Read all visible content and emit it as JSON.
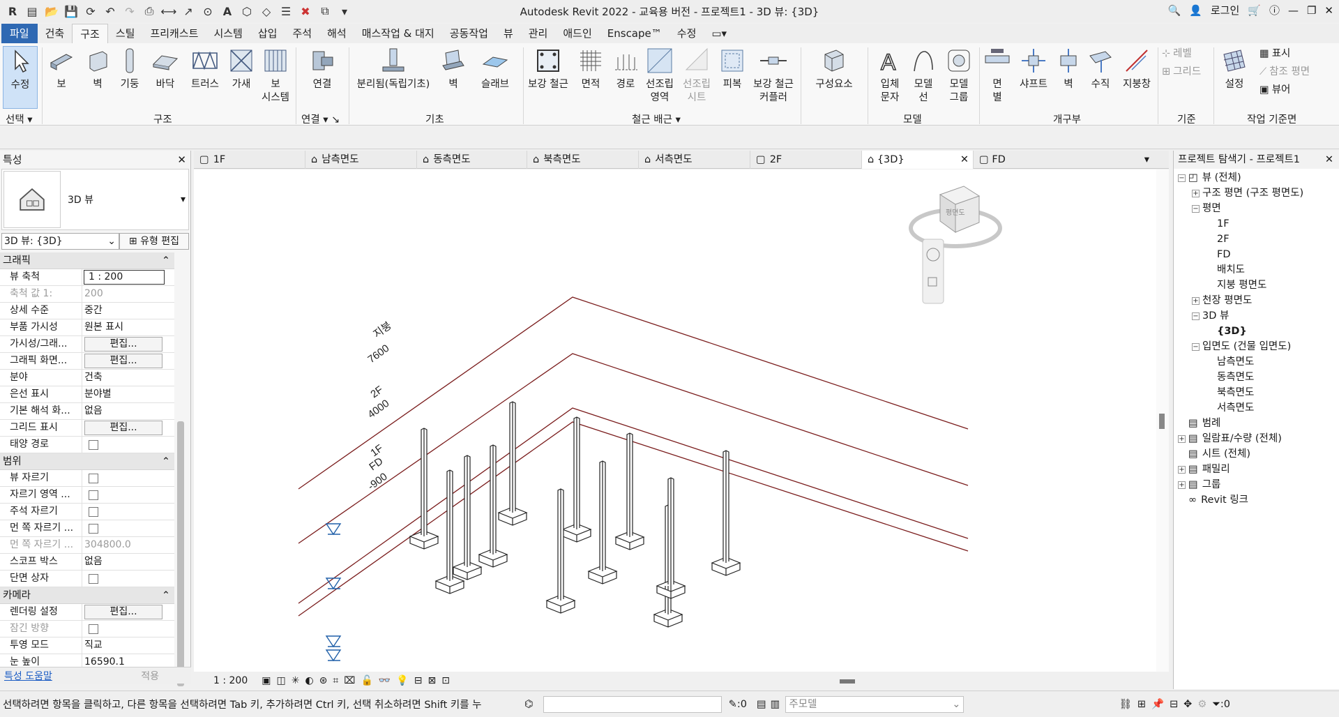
{
  "window": {
    "title": "Autodesk Revit 2022 - 교육용 버전 - 프로젝트1 - 3D 뷰: {3D}",
    "login": "로그인"
  },
  "ribbon_tabs": [
    "파일",
    "건축",
    "구조",
    "스틸",
    "프리캐스트",
    "시스템",
    "삽입",
    "주석",
    "해석",
    "매스작업 & 대지",
    "공동작업",
    "뷰",
    "관리",
    "애드인",
    "Enscape™",
    "수정"
  ],
  "ribbon": {
    "modify": "수정",
    "select": "선택",
    "structure_btns": [
      "보",
      "벽",
      "기둥",
      "바닥",
      "트러스",
      "가새",
      "보\n시스템"
    ],
    "connection_btn": "연결",
    "foundation_btns": [
      "분리됨(독립기초)",
      "벽",
      "슬래브"
    ],
    "rebar_btns": [
      "보강 철근",
      "면적",
      "경로",
      "선조립\n영역",
      "선조립\n시트",
      "피복",
      "보강 철근\n커플러"
    ],
    "component_btn": "구성요소",
    "model_btns": [
      "입체\n문자",
      "모델\n선",
      "모델\n그룹"
    ],
    "opening_btns": [
      "면\n별",
      "샤프트",
      "벽",
      "수직",
      "지붕창"
    ],
    "datum_btns": [
      "레벨",
      "그리드"
    ],
    "workplane_btns": [
      "설정",
      "표시",
      "참조 평면",
      "뷰어"
    ],
    "panels": [
      "구조",
      "연결",
      "기초",
      "철근 배근",
      "모델",
      "개구부",
      "기준",
      "작업 기준면"
    ]
  },
  "properties": {
    "header": "특성",
    "type_name": "3D 뷰",
    "selector": "3D 뷰: {3D}",
    "edit_type": "유형 편집",
    "groups": {
      "graphics": "그래픽",
      "extents": "범위",
      "camera": "카메라"
    },
    "graphics_rows": [
      {
        "k": "뷰 축척",
        "v": "1 : 200"
      },
      {
        "k": "축척 값    1:",
        "v": "200"
      },
      {
        "k": "상세 수준",
        "v": "중간"
      },
      {
        "k": "부품 가시성",
        "v": "원본 표시"
      },
      {
        "k": "가시성/그래...",
        "v": "편집..."
      },
      {
        "k": "그래픽 화면...",
        "v": "편집..."
      },
      {
        "k": "분야",
        "v": "건축"
      },
      {
        "k": "은선 표시",
        "v": "분야별"
      },
      {
        "k": "기본 해석 화...",
        "v": "없음"
      },
      {
        "k": "그리드 표시",
        "v": "편집..."
      },
      {
        "k": "태양 경로",
        "v": ""
      }
    ],
    "extents_rows": [
      {
        "k": "뷰 자르기",
        "v": ""
      },
      {
        "k": "자르기 영역 ...",
        "v": ""
      },
      {
        "k": "주석 자르기",
        "v": ""
      },
      {
        "k": "먼 쪽 자르기 ...",
        "v": ""
      },
      {
        "k": "먼 쪽 자르기 ...",
        "v": "304800.0"
      },
      {
        "k": "스코프 박스",
        "v": "없음"
      },
      {
        "k": "단면 상자",
        "v": ""
      }
    ],
    "camera_rows": [
      {
        "k": "렌더링 설정",
        "v": "편집..."
      },
      {
        "k": "잠긴 방향",
        "v": ""
      },
      {
        "k": "투영 모드",
        "v": "직교"
      },
      {
        "k": "눈 높이",
        "v": "16590.1"
      }
    ],
    "help": "특성 도움말",
    "apply": "적용"
  },
  "view_tabs": [
    "1F",
    "남측면도",
    "동측면도",
    "북측면도",
    "서측면도",
    "2F",
    "{3D}",
    "FD"
  ],
  "view": {
    "scale": "1 : 200",
    "levels": [
      {
        "name": "지붕",
        "elev": "7600"
      },
      {
        "name": "2F",
        "elev": "4000"
      },
      {
        "name": "1F",
        "elev": ""
      },
      {
        "name": "FD",
        "elev": "-900"
      }
    ],
    "viewcube_label": "평면도"
  },
  "browser": {
    "header": "프로젝트 탐색기 - 프로젝트1",
    "nodes": [
      {
        "label": "뷰 (전체)",
        "level": 0,
        "exp": "−"
      },
      {
        "label": "구조 평면 (구조 평면도)",
        "level": 1,
        "exp": "+"
      },
      {
        "label": "평면",
        "level": 1,
        "exp": "−"
      },
      {
        "label": "1F",
        "level": 2,
        "exp": ""
      },
      {
        "label": "2F",
        "level": 2,
        "exp": ""
      },
      {
        "label": "FD",
        "level": 2,
        "exp": ""
      },
      {
        "label": "배치도",
        "level": 2,
        "exp": ""
      },
      {
        "label": "지붕 평면도",
        "level": 2,
        "exp": ""
      },
      {
        "label": "천장 평면도",
        "level": 1,
        "exp": "+"
      },
      {
        "label": "3D 뷰",
        "level": 1,
        "exp": "−"
      },
      {
        "label": "{3D}",
        "level": 2,
        "exp": ""
      },
      {
        "label": "입면도 (건물 입면도)",
        "level": 1,
        "exp": "−"
      },
      {
        "label": "남측면도",
        "level": 2,
        "exp": ""
      },
      {
        "label": "동측면도",
        "level": 2,
        "exp": ""
      },
      {
        "label": "북측면도",
        "level": 2,
        "exp": ""
      },
      {
        "label": "서측면도",
        "level": 2,
        "exp": ""
      },
      {
        "label": "범례",
        "level": 0,
        "exp": ""
      },
      {
        "label": "일람표/수량 (전체)",
        "level": 0,
        "exp": "+"
      },
      {
        "label": "시트 (전체)",
        "level": 0,
        "exp": ""
      },
      {
        "label": "패밀리",
        "level": 0,
        "exp": "+"
      },
      {
        "label": "그룹",
        "level": 0,
        "exp": "+"
      },
      {
        "label": "Revit 링크",
        "level": 0,
        "exp": ""
      }
    ]
  },
  "status": {
    "message": "선택하려면 항목을 클릭하고, 다른 항목을 선택하려면 Tab 키, 추가하려면 Ctrl 키, 선택 취소하려면 Shift 키를 누",
    "count": ":0",
    "model": "주모델",
    "filter": ":0"
  },
  "colors": {
    "accent": "#2f69b3",
    "level_line": "#7a1c1c"
  }
}
